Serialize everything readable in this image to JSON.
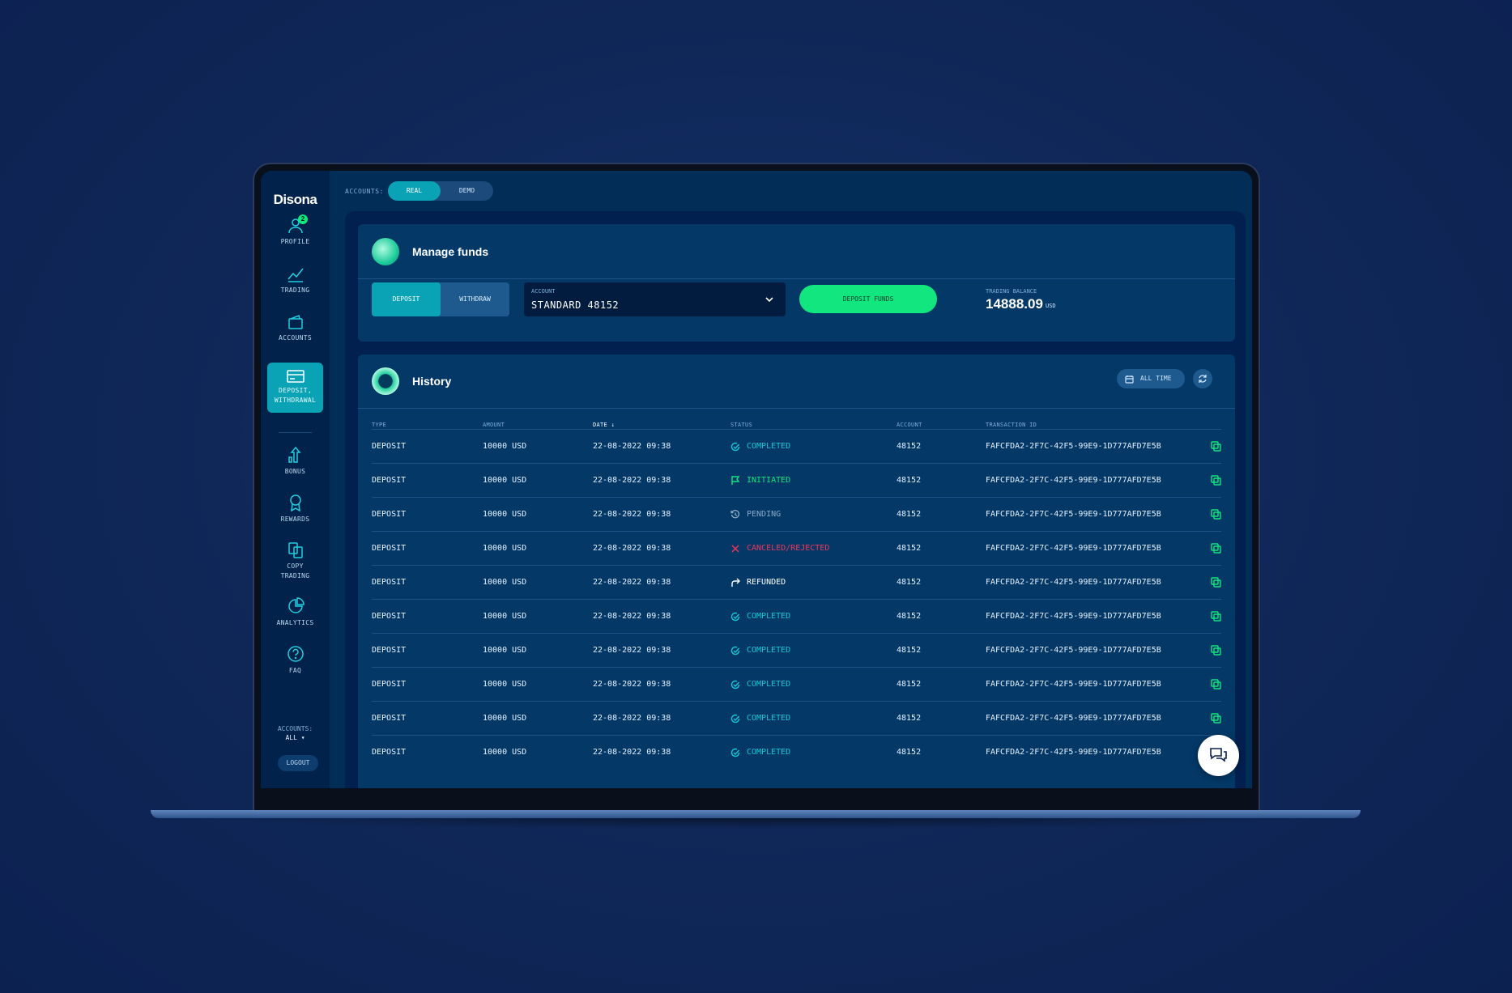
{
  "brand": "Disona",
  "sidebar": {
    "items": [
      {
        "label": "PROFILE",
        "icon": "profile-icon",
        "badge": "2"
      },
      {
        "label": "TRADING",
        "icon": "trading-chart-icon"
      },
      {
        "label": "ACCOUNTS",
        "icon": "wallet-icon"
      },
      {
        "label": "DEPOSIT,",
        "label2": "WITHDRAWAL",
        "icon": "card-icon",
        "active": true
      },
      {
        "label": "BONUS",
        "icon": "bonus-icon"
      },
      {
        "label": "REWARDS",
        "icon": "rewards-icon"
      },
      {
        "label": "COPY",
        "label2": "TRADING",
        "icon": "copy-trading-icon"
      },
      {
        "label": "ANALYTICS",
        "icon": "analytics-icon"
      },
      {
        "label": "FAQ",
        "icon": "faq-icon"
      }
    ],
    "accounts_label": "ACCOUNTS:",
    "accounts_value": "ALL",
    "logout": "LOGOUT"
  },
  "topbar": {
    "accounts_label": "ACCOUNTS:",
    "real": "REAL",
    "demo": "DEMO",
    "selected": "REAL"
  },
  "manage": {
    "title": "Manage funds",
    "deposit_tab": "DEPOSIT",
    "withdraw_tab": "WITHDRAW",
    "selected_tab": "DEPOSIT",
    "account_label": "ACCOUNT",
    "account_value": "STANDARD 48152",
    "deposit_button": "DEPOSIT FUNDS",
    "balance_label": "TRADING BALANCE",
    "balance_value": "14888.09",
    "balance_currency": "USD"
  },
  "history": {
    "title": "History",
    "filter": "ALL TIME",
    "columns": [
      "TYPE",
      "AMOUNT",
      "DATE",
      "STATUS",
      "ACCOUNT",
      "TRANSACTION ID"
    ],
    "rows": [
      {
        "type": "DEPOSIT",
        "amount": "10000 USD",
        "date": "22-08-2022 09:38",
        "status": "COMPLETED",
        "account": "48152",
        "txid": "FAFCFDA2-2F7C-42F5-99E9-1D777AFD7E5B"
      },
      {
        "type": "DEPOSIT",
        "amount": "10000 USD",
        "date": "22-08-2022 09:38",
        "status": "INITIATED",
        "account": "48152",
        "txid": "FAFCFDA2-2F7C-42F5-99E9-1D777AFD7E5B"
      },
      {
        "type": "DEPOSIT",
        "amount": "10000 USD",
        "date": "22-08-2022 09:38",
        "status": "PENDING",
        "account": "48152",
        "txid": "FAFCFDA2-2F7C-42F5-99E9-1D777AFD7E5B"
      },
      {
        "type": "DEPOSIT",
        "amount": "10000 USD",
        "date": "22-08-2022 09:38",
        "status": "CANCELED/REJECTED",
        "account": "48152",
        "txid": "FAFCFDA2-2F7C-42F5-99E9-1D777AFD7E5B"
      },
      {
        "type": "DEPOSIT",
        "amount": "10000 USD",
        "date": "22-08-2022 09:38",
        "status": "REFUNDED",
        "account": "48152",
        "txid": "FAFCFDA2-2F7C-42F5-99E9-1D777AFD7E5B"
      },
      {
        "type": "DEPOSIT",
        "amount": "10000 USD",
        "date": "22-08-2022 09:38",
        "status": "COMPLETED",
        "account": "48152",
        "txid": "FAFCFDA2-2F7C-42F5-99E9-1D777AFD7E5B"
      },
      {
        "type": "DEPOSIT",
        "amount": "10000 USD",
        "date": "22-08-2022 09:38",
        "status": "COMPLETED",
        "account": "48152",
        "txid": "FAFCFDA2-2F7C-42F5-99E9-1D777AFD7E5B"
      },
      {
        "type": "DEPOSIT",
        "amount": "10000 USD",
        "date": "22-08-2022 09:38",
        "status": "COMPLETED",
        "account": "48152",
        "txid": "FAFCFDA2-2F7C-42F5-99E9-1D777AFD7E5B"
      },
      {
        "type": "DEPOSIT",
        "amount": "10000 USD",
        "date": "22-08-2022 09:38",
        "status": "COMPLETED",
        "account": "48152",
        "txid": "FAFCFDA2-2F7C-42F5-99E9-1D777AFD7E5B"
      },
      {
        "type": "DEPOSIT",
        "amount": "10000 USD",
        "date": "22-08-2022 09:38",
        "status": "COMPLETED",
        "account": "48152",
        "txid": "FAFCFDA2-2F7C-42F5-99E9-1D777AFD7E5B"
      }
    ]
  },
  "colors": {
    "completed": "#18c6d6",
    "initiated": "#12e67e",
    "pending": "#8aa8c6",
    "canceled": "#f0355a",
    "refunded": "#ffffff",
    "accent": "#0aa2b5",
    "green": "#12e67e"
  }
}
